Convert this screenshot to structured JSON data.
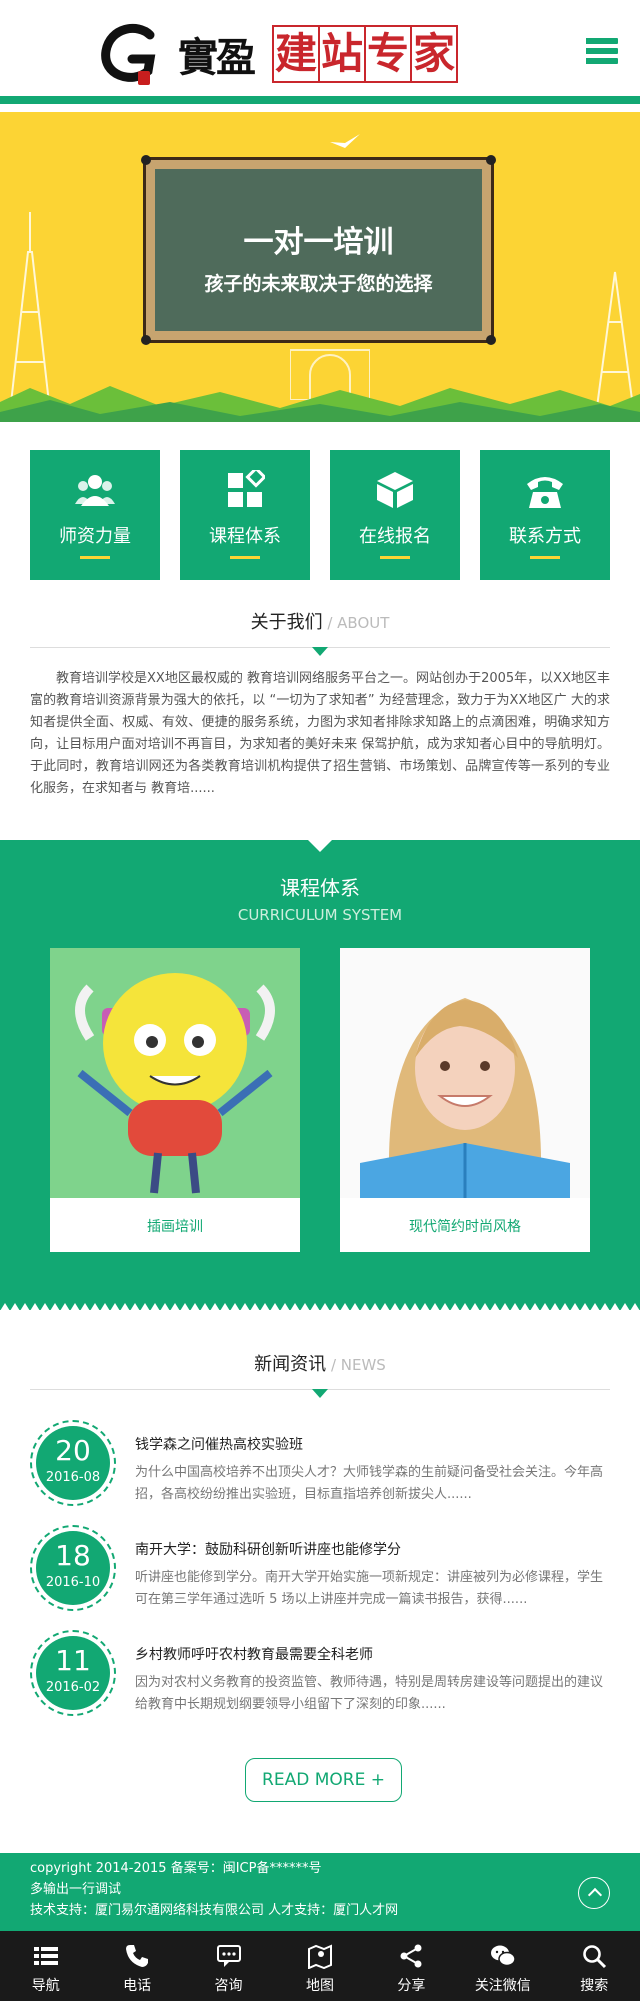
{
  "header": {
    "logo_mark": "G",
    "logo_calligraphy": "實盈",
    "logo_slogan": [
      "建",
      "站",
      "专",
      "家"
    ],
    "menu_icon": "list-menu-icon"
  },
  "banner": {
    "title": "一对一培训",
    "subtitle": "孩子的未来取决于您的选择"
  },
  "quick_nav": [
    {
      "label": "师资力量",
      "icon": "teachers-icon"
    },
    {
      "label": "课程体系",
      "icon": "blocks-icon"
    },
    {
      "label": "在线报名",
      "icon": "cube-icon"
    },
    {
      "label": "联系方式",
      "icon": "phone-icon"
    }
  ],
  "about": {
    "title_cn": "关于我们",
    "title_sep": " / ",
    "title_en": "ABOUT",
    "text": "教育培训学校是XX地区最权威的 教育培训网络服务平台之一。网站创办于2005年，以XX地区丰富的教育培训资源背景为强大的依托，以 “一切为了求知者” 为经营理念，致力于为XX地区广 大的求知者提供全面、权威、有效、便捷的服务系统，力图为求知者排除求知路上的点滴困难，明确求知方向，让目标用户面对培训不再盲目，为求知者的美好未来 保驾护航，成为求知者心目中的导航明灯。于此同时，教育培训网还为各类教育培训机构提供了招生营销、市场策划、品牌宣传等一系列的专业化服务，在求知者与 教育培......"
  },
  "curriculum": {
    "title_cn": "课程体系",
    "title_en": "CURRICULUM SYSTEM",
    "cards": [
      {
        "caption": "插画培训"
      },
      {
        "caption": "现代简约时尚风格"
      }
    ]
  },
  "news": {
    "title_cn": "新闻资讯",
    "title_sep": " / ",
    "title_en": "NEWS",
    "items": [
      {
        "day": "20",
        "month": "2016-08",
        "title": "钱学森之问催热高校实验班",
        "desc": "为什么中国高校培养不出顶尖人才？大师钱学森的生前疑问备受社会关注。今年高招，各高校纷纷推出实验班，目标直指培养创新拔尖人......"
      },
      {
        "day": "18",
        "month": "2016-10",
        "title": "南开大学：鼓励科研创新听讲座也能修学分",
        "desc": "听讲座也能修到学分。南开大学开始实施一项新规定：讲座被列为必修课程，学生可在第三学年通过选听 5 场以上讲座并完成一篇读书报告，获得......"
      },
      {
        "day": "11",
        "month": "2016-02",
        "title": "乡村教师呼吁农村教育最需要全科老师",
        "desc": "因为对农村义务教育的投资监管、教师待遇，特别是周转房建设等问题提出的建议给教育中长期规划纲要领导小组留下了深刻的印象......"
      }
    ],
    "more_label": "READ MORE",
    "more_icon": "+"
  },
  "footer": {
    "line1": "copyright 2014-2015 备案号：闽ICP备******号",
    "line2": "多输出一行调试",
    "line3": "技术支持：厦门易尔通网络科技有限公司 人才支持：厦门人才网"
  },
  "tabbar": [
    {
      "label": "导航",
      "icon": "list-icon"
    },
    {
      "label": "电话",
      "icon": "phone-icon"
    },
    {
      "label": "咨询",
      "icon": "chat-icon"
    },
    {
      "label": "地图",
      "icon": "map-icon"
    },
    {
      "label": "分享",
      "icon": "share-icon"
    },
    {
      "label": "关注微信",
      "icon": "wechat-icon"
    },
    {
      "label": "搜索",
      "icon": "search-icon"
    }
  ],
  "colors": {
    "brand_green": "#12a873",
    "banner_yellow": "#fcd434",
    "slogan_red": "#c9262c",
    "tabbar_dark": "#1a1a1a"
  }
}
